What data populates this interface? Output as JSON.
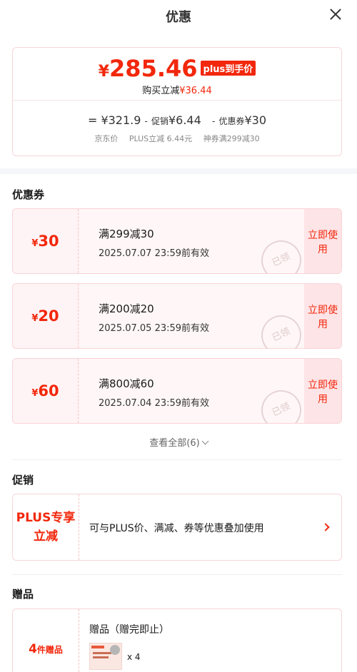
{
  "header": {
    "title": "优惠"
  },
  "price": {
    "symbol": "¥",
    "value": "285.46",
    "badge": "plus到手价",
    "buy_prefix": "购买立减",
    "buy_amount": "¥36.44"
  },
  "calc": {
    "eq": "=",
    "base": "¥321.9",
    "op1": "-",
    "promo_label": "促销",
    "promo_value": "¥6.44",
    "op2": "-",
    "coupon_label": "优惠券",
    "coupon_value": "¥30",
    "label_base": "京东价",
    "label_promo": "PLUS立减 6.44元",
    "label_coupon": "神券满299减30"
  },
  "coupons_section": {
    "title": "优惠券",
    "items": [
      {
        "symbol": "¥",
        "amount": "30",
        "condition": "满299减30",
        "valid": "2025.07.07 23:59前有效",
        "stamp": "已领",
        "use_label": "立即使用"
      },
      {
        "symbol": "¥",
        "amount": "20",
        "condition": "满200减20",
        "valid": "2025.07.05 23:59前有效",
        "stamp": "已领",
        "use_label": "立即使用"
      },
      {
        "symbol": "¥",
        "amount": "60",
        "condition": "满800减60",
        "valid": "2025.07.04 23:59前有效",
        "stamp": "已领",
        "use_label": "立即使用"
      }
    ],
    "view_all": "查看全部(6)"
  },
  "promo_section": {
    "title": "促销",
    "tag_line1": "PLUS专享",
    "tag_line2": "立减",
    "desc": "可与PLUS价、满减、券等优惠叠加使用"
  },
  "gift_section": {
    "title": "赠品",
    "tag_count": "4",
    "tag_text": "件赠品",
    "gift_title": "赠品（赠完即止）",
    "qty": "x 4"
  },
  "colors": {
    "accent": "#f2270c",
    "coupon_bg": "#fff4f5",
    "section_gap": "#f5f6fa"
  }
}
